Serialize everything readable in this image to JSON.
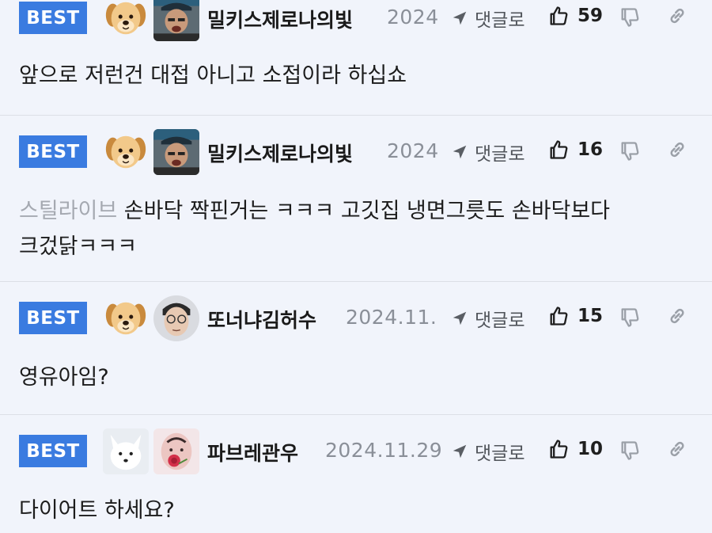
{
  "comments": [
    {
      "badge": "BEST",
      "nickname": "밀키스제로나의빛",
      "date": "2024",
      "reply_label": "댓글로",
      "likes": "59",
      "mention": "",
      "text": "앞으로 저런건 대접 아니고 소접이라 하십쇼",
      "text2": ""
    },
    {
      "badge": "BEST",
      "nickname": "밀키스제로나의빛",
      "date": "2024",
      "reply_label": "댓글로",
      "likes": "16",
      "mention": "스틸라이브",
      "text": " 손바닥 짝핀거는 ㅋㅋㅋ 고깃집 냉면그릇도 손바닥보다",
      "text2": "크겄닭ㅋㅋㅋ"
    },
    {
      "badge": "BEST",
      "nickname": "또너냐김허수",
      "date": "2024.11.",
      "reply_label": "댓글로",
      "likes": "15",
      "mention": "",
      "text": "영유아임?",
      "text2": ""
    },
    {
      "badge": "BEST",
      "nickname": "파브레관우",
      "date": "2024.11.29",
      "reply_label": "댓글로",
      "likes": "10",
      "mention": "",
      "text": "다이어트 하세요?",
      "text2": ""
    }
  ],
  "colors": {
    "badge": "#3a7be0",
    "background": "#f1f4fb",
    "mention": "#a5a9b1"
  },
  "icons": [
    "puppy-avatar",
    "user-photo-avatar",
    "arctic-fox-avatar",
    "reply-arrow-icon",
    "thumbs-up-icon",
    "thumbs-down-icon",
    "link-icon"
  ]
}
